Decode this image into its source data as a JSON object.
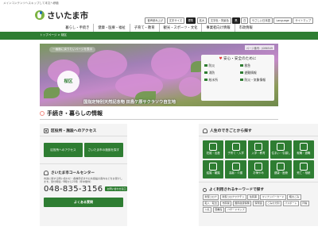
{
  "header": {
    "skip_link": "メインコンテンツへスキップして本文へ移動",
    "site_name": "さいたま市",
    "utility_links": [
      {
        "label": "音声読み上げ",
        "active": false
      },
      {
        "label": "文字サイズ",
        "active": false
      },
      {
        "label": "標準",
        "active": true
      },
      {
        "label": "拡大",
        "active": false
      },
      {
        "label": "文字色・背景色",
        "active": false
      },
      {
        "label": "黒",
        "active": true
      },
      {
        "label": "白",
        "active": false
      },
      {
        "label": "やさしい日本語",
        "active": false
      },
      {
        "label": "Language",
        "active": false
      },
      {
        "label": "サイトマップ",
        "active": false
      }
    ]
  },
  "global_nav": [
    "暮らし・手続き",
    "健康・医療・福祉",
    "子育て・教育",
    "観光・スポーツ・文化",
    "事業者向け情報",
    "市政情報"
  ],
  "breadcrumb": {
    "home": "トップページ",
    "separator": ">",
    "current": "桜区"
  },
  "hero": {
    "note": "一画面に戻りたいページを表示",
    "ward_name": "桜区",
    "updated": "ページ番号：J086549",
    "caption": "国指定特別天然記念物 田島ケ原サクラソウ自生地"
  },
  "safety": {
    "title": "安心・安全のために",
    "items": [
      "防災",
      "救急",
      "消防",
      "避難情報",
      "給水所",
      "防災・気象情報"
    ]
  },
  "section_title": "手続き・暮らしの情報",
  "access": {
    "heading": "区役所・施設へのアクセス",
    "buttons": [
      "区役所へのアクセス",
      "さいたま市の施設を探す"
    ]
  },
  "callcenter": {
    "heading": "さいたま市コールセンター",
    "description": "市政に関する問い合わせ・各種手続きや公共施設の案内などをお受けします。受付時間／8時から21時（年中無休）",
    "phone": "048-835-3156",
    "side_button": "お問い合わせ窓口",
    "faq_button": "よくある質問"
  },
  "life": {
    "heading": "人生のできごとから探す",
    "tiles": [
      "妊娠・出産",
      "子育て・入学",
      "入学・教育",
      "住まい・引越し",
      "就職・退職",
      "結婚・離婚",
      "高齢・介護",
      "お悔やみ",
      "健康・医療",
      "死亡・相続"
    ]
  },
  "keywords": {
    "heading": "よく利用されるキーワードで探す",
    "tags": [
      "新型コロナ",
      "新型コロナワクチン",
      "住民票",
      "マイナンバーカード",
      "粗大ごみ",
      "転入・転出",
      "市民税",
      "国民健康保険",
      "保育園",
      "ごみの分別",
      "パスポート",
      "戸籍",
      "入札",
      "図書館",
      "ハザードマップ"
    ]
  }
}
